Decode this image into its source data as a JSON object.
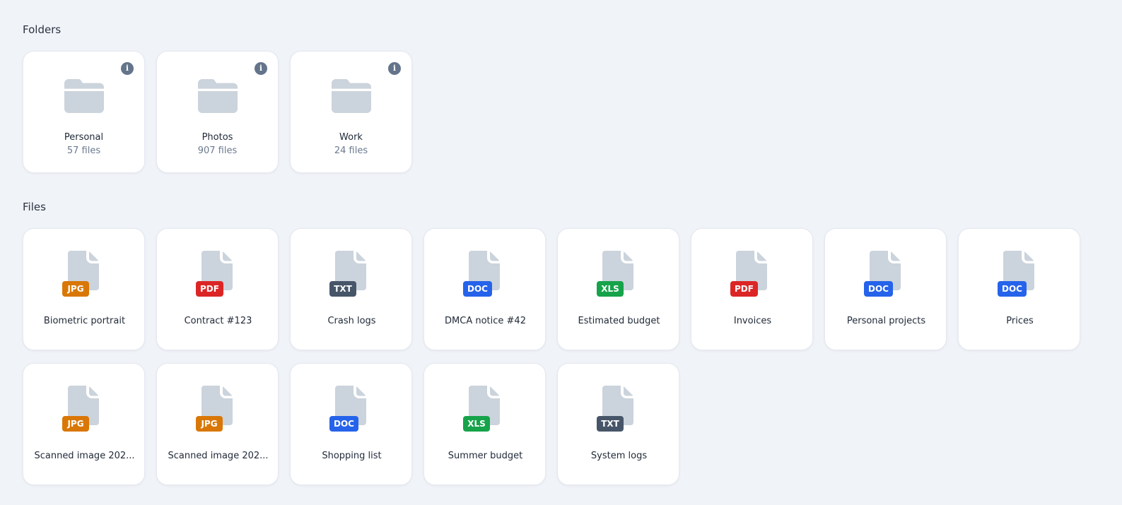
{
  "sections": {
    "folders_title": "Folders",
    "files_title": "Files"
  },
  "folders": [
    {
      "name": "Personal",
      "count": "57 files"
    },
    {
      "name": "Photos",
      "count": "907 files"
    },
    {
      "name": "Work",
      "count": "24 files"
    }
  ],
  "files": [
    {
      "name": "Biometric portrait",
      "type": "JPG"
    },
    {
      "name": "Contract #123",
      "type": "PDF"
    },
    {
      "name": "Crash logs",
      "type": "TXT"
    },
    {
      "name": "DMCA notice #42",
      "type": "DOC"
    },
    {
      "name": "Estimated budget",
      "type": "XLS"
    },
    {
      "name": "Invoices",
      "type": "PDF"
    },
    {
      "name": "Personal projects",
      "type": "DOC"
    },
    {
      "name": "Prices",
      "type": "DOC"
    },
    {
      "name": "Scanned image 202...",
      "type": "JPG"
    },
    {
      "name": "Scanned image 202...",
      "type": "JPG"
    },
    {
      "name": "Shopping list",
      "type": "DOC"
    },
    {
      "name": "Summer budget",
      "type": "XLS"
    },
    {
      "name": "System logs",
      "type": "TXT"
    }
  ],
  "badge_colors": {
    "JPG": "#d97706",
    "PDF": "#dc2626",
    "TXT": "#475569",
    "DOC": "#2563eb",
    "XLS": "#16a34a"
  },
  "icons": {
    "folder": "folder-icon",
    "file": "file-icon",
    "info": "info-icon"
  },
  "info_glyph": "i"
}
